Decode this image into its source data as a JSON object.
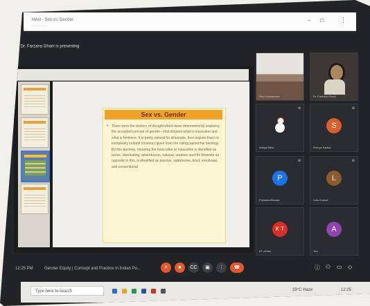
{
  "browser": {
    "tab_title": "Meet - Sex vs. Gender",
    "menu_icon": "kebab-menu-icon"
  },
  "meeting": {
    "header": "Dr. Farzana Ghani is presenting",
    "time": "12:25 PM",
    "title": "Gender Equity | Concept and Practice in Indian Po..."
  },
  "slide": {
    "title": "Sex vs. Gender",
    "body": "There were the doctors of thought which were determined by anatomy; the accepted concept of gender—that dictates what is masculine and what is feminine. It is pretty natural for all people, then argues that it is completely cultural construct given from the ruling patriarchal ideology. By this doctrine, meaning the masculine or masculine is identified as active, dominating, adventurous, rational, creative and the feminine as opposite to this, is identified as passive, submissive, timid, emotional, and conventional."
  },
  "participants": [
    {
      "id": "classroom",
      "name": "Sec A classroom",
      "type": "video"
    },
    {
      "id": "farzana",
      "name": "Dr. Farzana Ghani",
      "type": "video"
    },
    {
      "id": "aditya",
      "name": "Aditya Mitra",
      "type": "snowman"
    },
    {
      "id": "s",
      "name": "Shreya Sarkar",
      "initial": "S",
      "color": "#d9602c"
    },
    {
      "id": "p",
      "name": "Priyanka Biswas",
      "initial": "P",
      "color": "#1a73e8"
    },
    {
      "id": "l",
      "name": "Lata Kumari",
      "initial": "L",
      "color": "#8d5a2b"
    },
    {
      "id": "kt",
      "name": "KT others",
      "initial": "K T",
      "color": "#d93025"
    },
    {
      "id": "a",
      "name": "You",
      "initial": "A",
      "color": "#8e44ad"
    }
  ],
  "controls": {
    "mic": "mic-off-icon",
    "camera": "camera-off-icon",
    "captions": "CC",
    "present": "present-icon",
    "more": "more-icon",
    "leave": "end-call-icon"
  },
  "taskbar": {
    "search_placeholder": "Type here to search",
    "weather": "29°C Haze",
    "clock": "12:25"
  }
}
